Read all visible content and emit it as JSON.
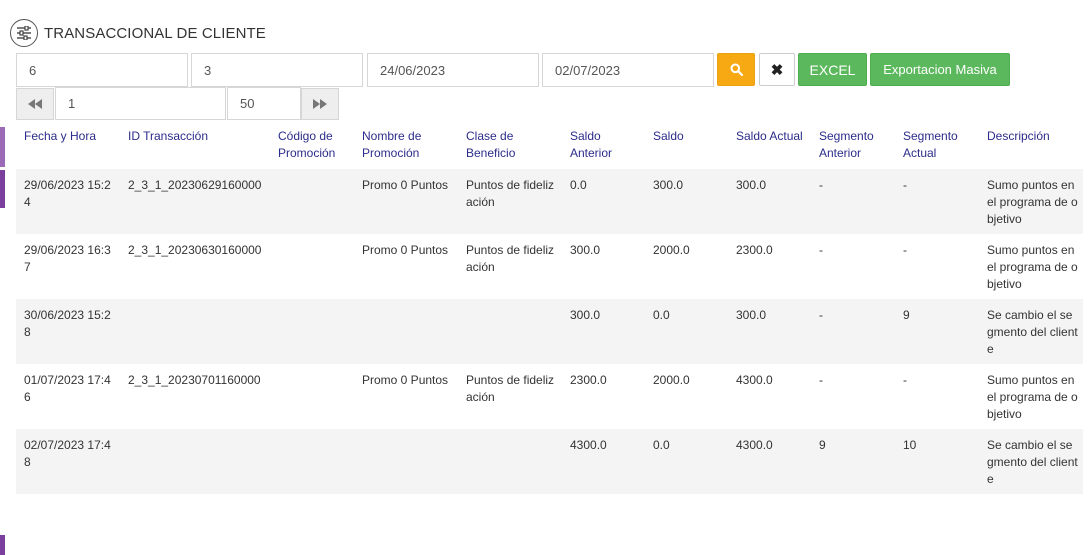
{
  "header": {
    "title": "TRANSACCIONAL DE CLIENTE",
    "icon": "filter-settings-icon"
  },
  "filters": {
    "field1": "6",
    "field2": "3",
    "date_from": "24/06/2023",
    "date_to": "02/07/2023",
    "search_icon": "search-icon",
    "clear_label": "✖",
    "excel_label": "EXCEL",
    "masiva_label": "Exportacion Masiva"
  },
  "pagination": {
    "page": "1",
    "page_size": "50"
  },
  "table": {
    "columns": [
      "Fecha y Hora",
      "ID Transacción",
      "Código de Promoción",
      "Nombre de Promoción",
      "Clase de Beneficio",
      "Saldo Anterior",
      "Saldo",
      "Saldo Actual",
      "Segmento Anterior",
      "Segmento Actual",
      "Descripción"
    ],
    "rows": [
      [
        "29/06/2023 15:24",
        "2_3_1_20230629160000",
        "",
        "Promo 0 Puntos",
        "Puntos de fidelización",
        "0.0",
        "300.0",
        "300.0",
        "-",
        "-",
        "Sumo puntos en el programa de objetivo"
      ],
      [
        "29/06/2023 16:37",
        "2_3_1_20230630160000",
        "",
        "Promo 0 Puntos",
        "Puntos de fidelización",
        "300.0",
        "2000.0",
        "2300.0",
        "-",
        "-",
        "Sumo puntos en el programa de objetivo"
      ],
      [
        "30/06/2023 15:28",
        "",
        "",
        "",
        "",
        "300.0",
        "0.0",
        "300.0",
        "-",
        "9",
        "Se cambio el segmento del cliente"
      ],
      [
        "01/07/2023 17:46",
        "2_3_1_20230701160000",
        "",
        "Promo 0 Puntos",
        "Puntos de fidelización",
        "2300.0",
        "2000.0",
        "4300.0",
        "-",
        "-",
        "Sumo puntos en el programa de objetivo"
      ],
      [
        "02/07/2023 17:48",
        "",
        "",
        "",
        "",
        "4300.0",
        "0.0",
        "4300.0",
        "9",
        "10",
        "Se cambio el segmento del cliente"
      ]
    ]
  }
}
